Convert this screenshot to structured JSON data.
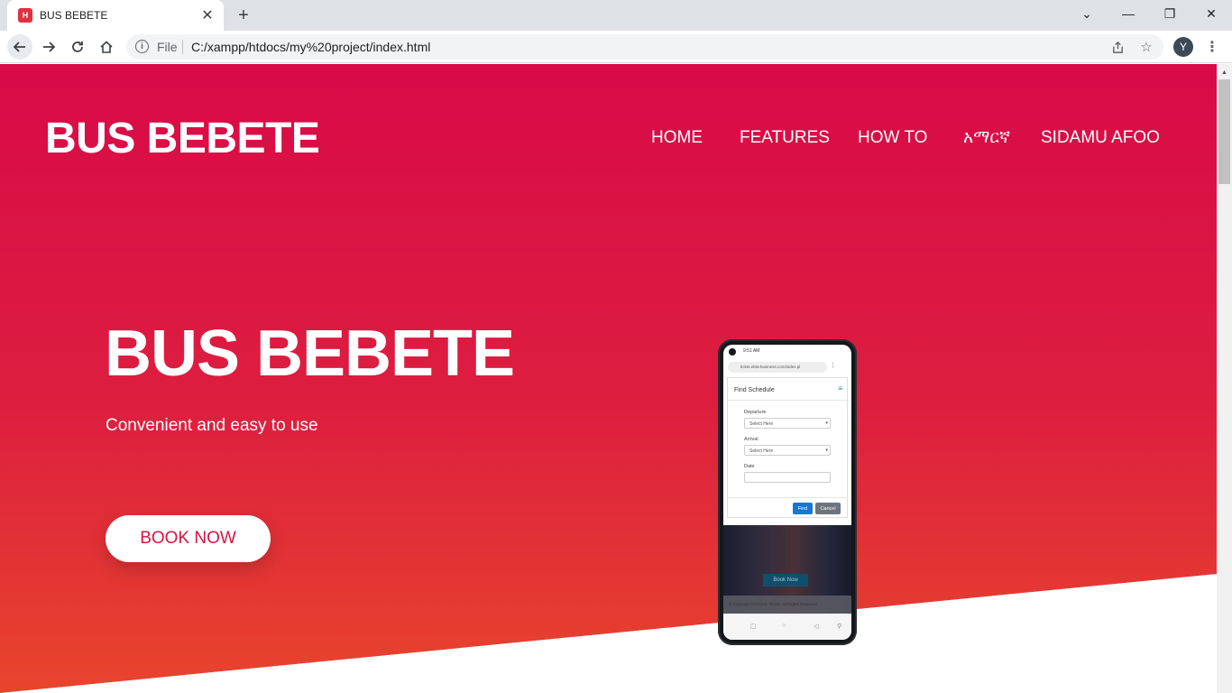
{
  "browser": {
    "tab_title": "BUS BEBETE",
    "tab_favicon_letter": "H",
    "scheme_label": "File",
    "url": "C:/xampp/htdocs/my%20project/index.html",
    "profile_initial": "Y"
  },
  "page": {
    "brand": "BUS BEBETE",
    "nav": [
      "HOME",
      "FEATURES",
      "HOW TO",
      "አማርኛ",
      "SIDAMU AFOO"
    ],
    "hero_title": "BUS BEBETE",
    "hero_subtitle": "Convenient and easy to use",
    "cta": "BOOK NOW",
    "colors": {
      "gradient_top": "#d80a48",
      "gradient_bottom": "#e8452c",
      "cta_text": "#d8143f"
    }
  },
  "phone": {
    "status_time": "9:51 AM",
    "address": "ticket.ebta-business.com/index.pl",
    "modal_title": "Find Schedule",
    "departure_label": "Departure",
    "departure_value": "Select Here",
    "arrival_label": "Arrival",
    "arrival_value": "Select Here",
    "date_label": "Date",
    "find_button": "Find",
    "cancel_button": "Cancel",
    "book_now": "Book Now",
    "footer": "© Copyright HAYOLE TEAM. All Rights Reserved"
  }
}
